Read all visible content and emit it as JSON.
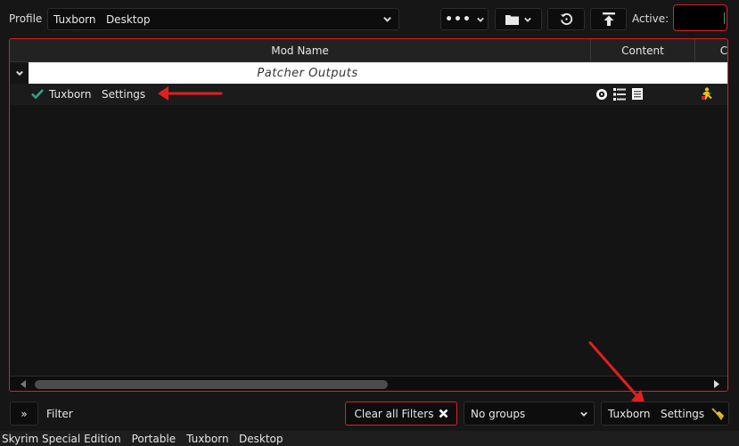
{
  "toolbar": {
    "profile_label": "Profile",
    "profile_value": "Tuxborn   Desktop",
    "active_label": "Active:"
  },
  "columns": {
    "mod_name": "Mod Name",
    "content": "Content",
    "truncated": "C"
  },
  "group_separator": "Patcher Outputs",
  "mods": [
    {
      "name": "Tuxborn   Settings",
      "enabled": true
    }
  ],
  "bottom": {
    "expand_label": "»",
    "filter_label": "Filter",
    "clear_filters_label": "Clear all Filters",
    "groups_value": "No groups",
    "profile_settings_label": "Tuxborn   Settings"
  },
  "status_bar": {
    "game": "Skyrim Special Edition",
    "mode": "Portable",
    "profile": "Tuxborn   Desktop"
  },
  "colors": {
    "accent_red": "#e02020",
    "check_teal": "#2aa58c",
    "background": "#161616"
  }
}
